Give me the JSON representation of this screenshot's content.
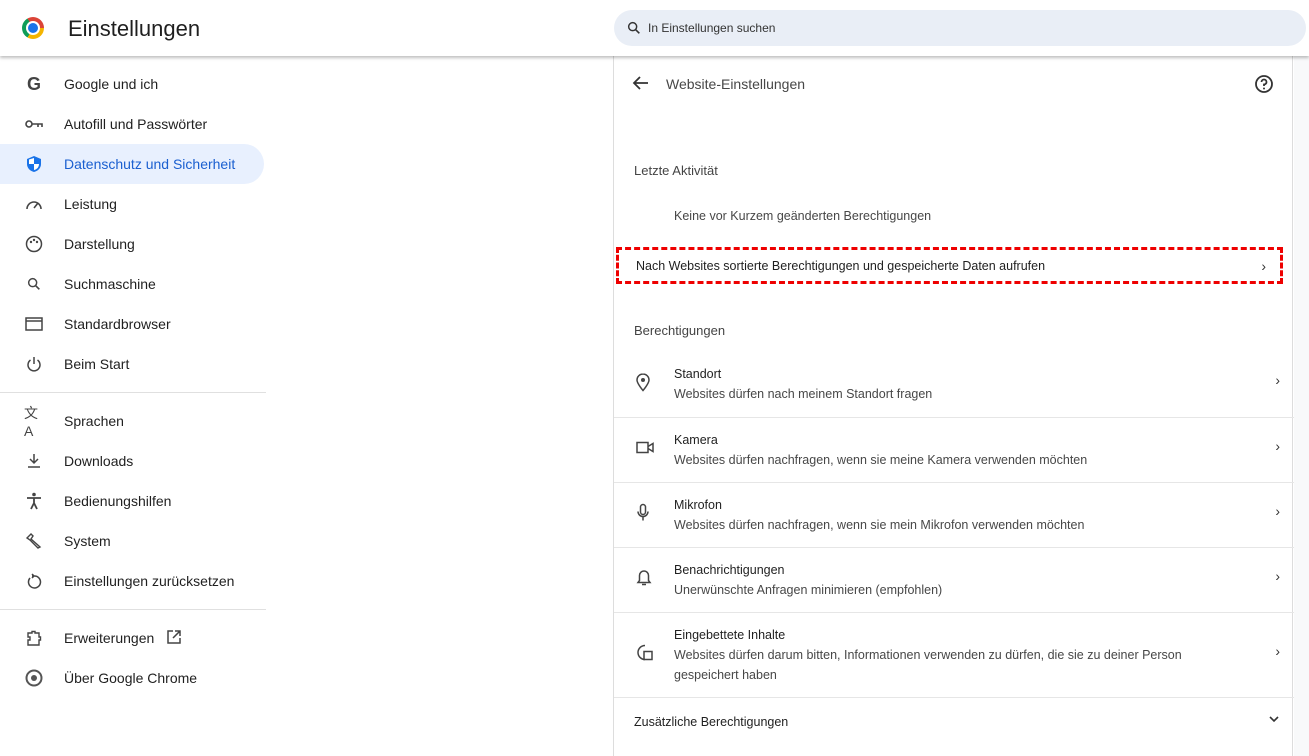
{
  "header": {
    "title": "Einstellungen",
    "search_placeholder": "In Einstellungen suchen"
  },
  "nav": {
    "items": [
      {
        "label": "Google und ich",
        "icon": "google-icon"
      },
      {
        "label": "Autofill und Passwörter",
        "icon": "key-icon"
      },
      {
        "label": "Datenschutz und Sicherheit",
        "icon": "shield-icon",
        "active": true
      },
      {
        "label": "Leistung",
        "icon": "speedometer-icon"
      },
      {
        "label": "Darstellung",
        "icon": "palette-icon"
      },
      {
        "label": "Suchmaschine",
        "icon": "search-icon"
      },
      {
        "label": "Standardbrowser",
        "icon": "browser-icon"
      },
      {
        "label": "Beim Start",
        "icon": "power-icon"
      }
    ],
    "items2": [
      {
        "label": "Sprachen",
        "icon": "translate-icon"
      },
      {
        "label": "Downloads",
        "icon": "download-icon"
      },
      {
        "label": "Bedienungshilfen",
        "icon": "accessibility-icon"
      },
      {
        "label": "System",
        "icon": "wrench-icon"
      },
      {
        "label": "Einstellungen zurücksetzen",
        "icon": "reset-icon"
      }
    ],
    "items3": [
      {
        "label": "Erweiterungen",
        "icon": "extension-icon"
      },
      {
        "label": "Über Google Chrome",
        "icon": "chrome-icon"
      }
    ]
  },
  "content": {
    "title": "Website-Einstellungen",
    "recent_heading": "Letzte Aktivität",
    "recent_empty": "Keine vor Kurzem geänderten Berechtigungen",
    "view_by_site": "Nach Websites sortierte Berechtigungen und gespeicherte Daten aufrufen",
    "permissions_heading": "Berechtigungen",
    "permissions": [
      {
        "title": "Standort",
        "subtitle": "Websites dürfen nach meinem Standort fragen",
        "icon": "location-icon"
      },
      {
        "title": "Kamera",
        "subtitle": "Websites dürfen nachfragen, wenn sie meine Kamera verwenden möchten",
        "icon": "camera-icon"
      },
      {
        "title": "Mikrofon",
        "subtitle": "Websites dürfen nachfragen, wenn sie mein Mikrofon verwenden möchten",
        "icon": "microphone-icon"
      },
      {
        "title": "Benachrichtigungen",
        "subtitle": "Unerwünschte Anfragen minimieren (empfohlen)",
        "icon": "bell-icon"
      },
      {
        "title": "Eingebettete Inhalte",
        "subtitle": "Websites dürfen darum bitten, Informationen verwenden zu dürfen, die sie zu deiner Person gespeichert haben",
        "icon": "embedded-content-icon"
      }
    ],
    "additional": "Zusätzliche Berechtigungen"
  }
}
